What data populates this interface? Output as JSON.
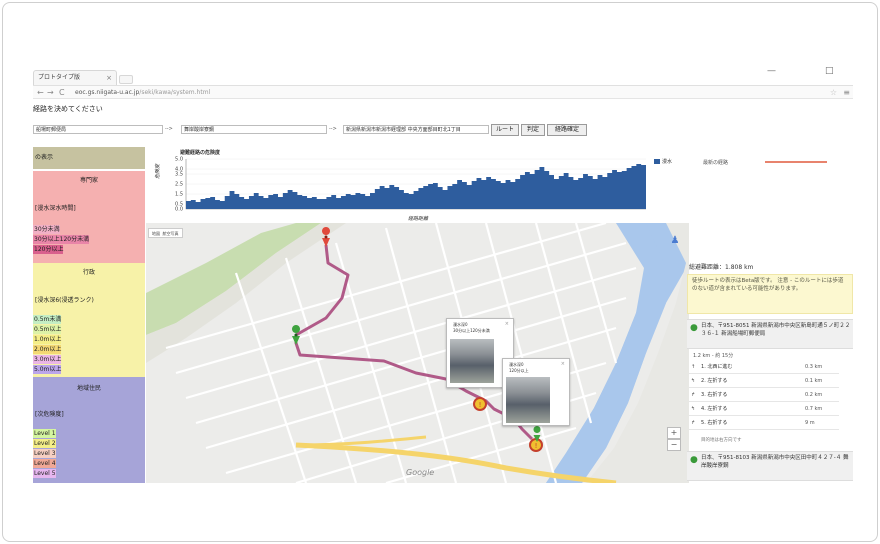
{
  "browser": {
    "tab_title": "プロトタイプ版",
    "tab_close": "×",
    "win_min": "—",
    "win_max": "□",
    "url_host": "eoc.gs.niigata-u.ac.jp",
    "url_path": "/seki/kawa/system.html"
  },
  "page": {
    "heading": "経路を決めてください"
  },
  "route_form": {
    "from": "船場町郵便局",
    "arrow1": "-->",
    "via": "舞岸酸岸寮鋼",
    "arrow2": "-->",
    "to": "新潟県新潟市新潟市経理部 中央方面部目町北1丁目",
    "buttons": [
      "ルート",
      "判定",
      "経路確定"
    ]
  },
  "legend": {
    "header": "の表示",
    "sections": [
      {
        "title": "専門家",
        "sub": "[漫水深水時間]",
        "items": [
          "30分未満",
          "30分以上120分未満",
          "120分以上"
        ],
        "item_colors": [
          "#f2b0c6",
          "#e985a8",
          "#d9608d"
        ]
      },
      {
        "title": "行政",
        "sub": "[浸水深6(浸透ランク)",
        "items": [
          "0.5m未満",
          "0.5m以上",
          "1.0m以上",
          "2.0m以上",
          "3.0m以上",
          "5.0m以上"
        ],
        "item_colors": [
          "#c4eec4",
          "#ddf2a6",
          "#f5ee88",
          "#f4d874",
          "#ebb6e6",
          "#bba6ea"
        ]
      },
      {
        "title": "地域住民",
        "sub": "[次危険度]",
        "items": [
          "Level 1",
          "Level 2",
          "Level 3",
          "Level 4",
          "Level 5"
        ],
        "item_colors": [
          "#d4f5a0",
          "#f5ee88",
          "#f6cfc2",
          "#f0a896",
          "#e6b6ef"
        ]
      }
    ],
    "colors": {
      "header_bg": "#c6c2a0",
      "expert_bg": "#f5b0b0",
      "admin_bg": "#f7f2a8",
      "resident_bg": "#a6a4d8"
    }
  },
  "chart_data": {
    "type": "area",
    "title": "避難経路の危険度",
    "xlabel": "経路距離",
    "ylabel": "危険度",
    "ylim": [
      0,
      5.0
    ],
    "yticks": [
      "0.0",
      "0.5",
      "1.5",
      "2.5",
      "3.5",
      "4.0",
      "5.0"
    ],
    "series": [
      {
        "name": "漫水",
        "color": "#2e5d9e",
        "values": [
          0.8,
          0.9,
          0.7,
          1.0,
          1.1,
          1.2,
          0.9,
          0.8,
          1.3,
          1.8,
          1.5,
          1.2,
          1.0,
          1.3,
          1.6,
          1.3,
          1.1,
          1.4,
          1.5,
          1.2,
          1.6,
          1.9,
          1.7,
          1.4,
          1.3,
          1.1,
          1.2,
          1.0,
          1.0,
          1.2,
          1.4,
          1.1,
          1.3,
          1.5,
          1.4,
          1.6,
          1.5,
          1.3,
          1.6,
          2.0,
          2.3,
          2.1,
          2.4,
          2.2,
          1.9,
          1.6,
          1.5,
          1.8,
          2.1,
          2.3,
          2.5,
          2.6,
          2.2,
          1.9,
          2.3,
          2.5,
          2.9,
          2.7,
          2.4,
          2.8,
          3.1,
          2.9,
          3.2,
          3.0,
          2.8,
          2.6,
          2.9,
          2.7,
          3.0,
          3.4,
          3.7,
          3.5,
          3.9,
          4.2,
          3.8,
          3.4,
          3.0,
          3.3,
          3.6,
          3.2,
          2.9,
          3.1,
          3.5,
          3.3,
          3.0,
          3.4,
          3.2,
          3.6,
          3.9,
          3.7,
          3.8,
          4.1,
          4.3,
          4.5,
          4.4
        ]
      }
    ]
  },
  "map": {
    "toggle_labels": [
      "地図",
      "航空写真"
    ],
    "logo": "Google",
    "zoom_in": "+",
    "zoom_out": "−",
    "route_color": "#b05a88",
    "popups": [
      {
        "title": "漫水深0",
        "detail": "30分以上120分未満",
        "close": "×"
      },
      {
        "title": "漫水深0",
        "detail": "120分以上",
        "close": "×"
      }
    ],
    "icons": [
      "red-map-pin",
      "green-map-pin",
      "warning-marker",
      "pegman-icon"
    ]
  },
  "right_panel": {
    "legend_label": "最新の経路",
    "legend_color": "#e8836d",
    "distance": "総避難距離：1.808 km",
    "warning": "徒歩ルートの表示はBeta版です。 注意 - このルートには歩道のない道が含まれている可能性があります。",
    "start_address": "日本、〒951-8051 新潟県新潟市中央区新島町通５ノ町２２３６-１ 新潟船場町郵便局",
    "summary": "1.2 km - 約 15分",
    "steps": [
      {
        "num": "1",
        "icon": "↑",
        "text": "北西に進む",
        "dist": "0.3 km"
      },
      {
        "num": "2",
        "icon": "↰",
        "text": "左折する",
        "dist": "0.1 km"
      },
      {
        "num": "3",
        "icon": "↱",
        "text": "右折する",
        "dist": "0.2 km"
      },
      {
        "num": "4",
        "icon": "↰",
        "text": "左折する",
        "dist": "0.7 km"
      },
      {
        "num": "5",
        "icon": "↱",
        "text": "右折する",
        "dist": "9 m"
      }
    ],
    "note": "目的地は右方向です",
    "end_address": "日本、〒951-8103 新潟県新潟市中央区田中町４２７-４ 舞岸酸岸寮鋼"
  }
}
